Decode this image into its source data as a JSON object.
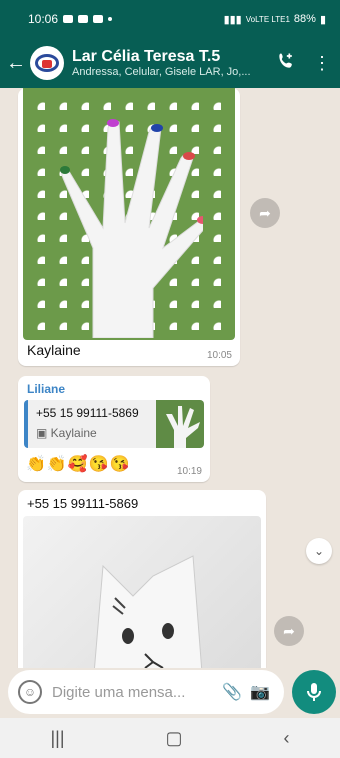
{
  "status": {
    "time": "10:06",
    "network": "VoLTE LTE1",
    "battery": "88%"
  },
  "header": {
    "title": "Lar Célia Teresa  T.5",
    "subtitle": "Andressa, Celular, Gisele LAR, Jo,..."
  },
  "messages": {
    "m1": {
      "caption": "Kaylaine",
      "time": "10:05"
    },
    "m2": {
      "sender": "Liliane",
      "quote_number": "+55 15 99111-5869",
      "quote_name": "Kaylaine",
      "emojis": "👏👏🥰😘😘",
      "time": "10:19"
    },
    "m3": {
      "number": "+55 15 99111-5869"
    }
  },
  "composer": {
    "placeholder": "Digite uma mensa..."
  },
  "colors": {
    "bar": "#075e54",
    "accent": "#128c7e",
    "chat_bg": "#ece5dd"
  }
}
